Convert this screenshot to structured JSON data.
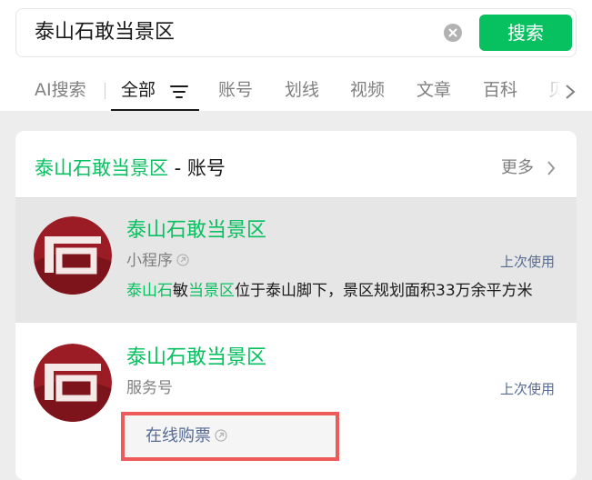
{
  "search": {
    "query": "泰山石敢当景区",
    "button_label": "搜索"
  },
  "tabs": [
    {
      "label": "AI搜索",
      "active": false
    },
    {
      "label": "全部",
      "active": true
    },
    {
      "label": "账号",
      "active": false
    },
    {
      "label": "划线",
      "active": false
    },
    {
      "label": "视频",
      "active": false
    },
    {
      "label": "文章",
      "active": false
    },
    {
      "label": "百科",
      "active": false
    },
    {
      "label": "贝",
      "active": false
    }
  ],
  "section": {
    "title_highlight": "泰山石敢当景区",
    "title_suffix": " - 账号",
    "more_label": "更多"
  },
  "accounts": [
    {
      "name": "泰山石敢当景区",
      "type": "小程序",
      "recent_label": "上次使用",
      "desc_parts": [
        "泰山石",
        "敏",
        "当景区",
        "位于泰山脚下，景区规划面积33万余平方米"
      ]
    },
    {
      "name": "泰山石敢当景区",
      "type": "服务号",
      "recent_label": "上次使用",
      "service_link": "在线购票"
    }
  ],
  "colors": {
    "accent": "#07c160",
    "link": "#576b95",
    "highlight_border": "#ee5b5b",
    "avatar_red": "#9b1c25"
  }
}
